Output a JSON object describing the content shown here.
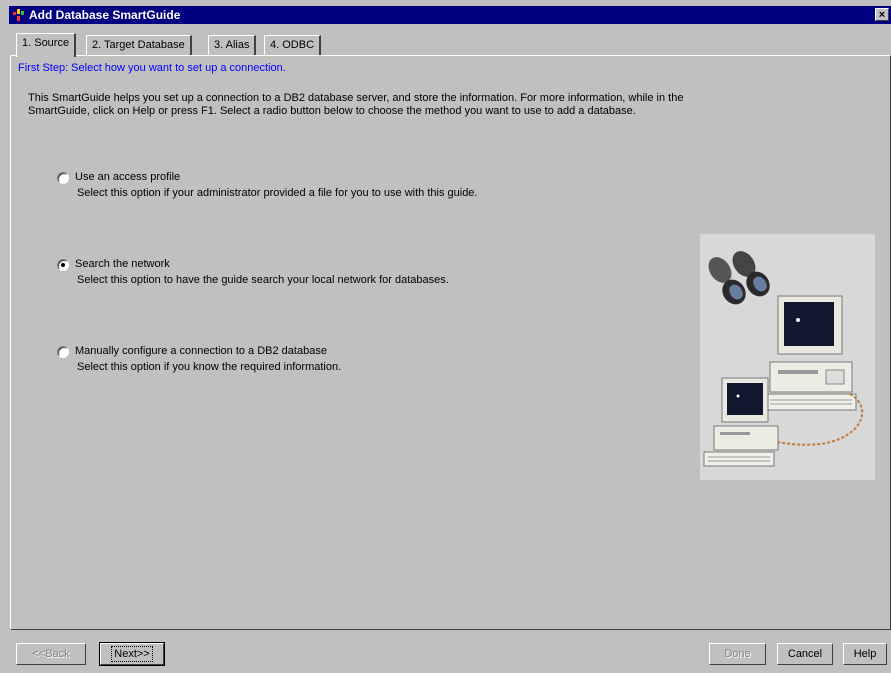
{
  "window": {
    "title": "Add Database SmartGuide",
    "close_glyph": "×"
  },
  "tabs": [
    {
      "label": "1. Source",
      "active": true
    },
    {
      "label": "2. Target Database",
      "active": false
    },
    {
      "label": "3. Alias",
      "active": false
    },
    {
      "label": "4. ODBC",
      "active": false
    }
  ],
  "step_heading": "First Step: Select how you want to set up a connection.",
  "intro": "This SmartGuide helps you set up a connection to a DB2 database server, and store the information.   For more information, while in the SmartGuide, click on Help or press F1.   Select a radio button below to choose the method you want to use to add a database.",
  "options": [
    {
      "label": "Use an access profile",
      "description": "Select this option if your administrator provided a file for you to use with this guide.",
      "selected": false
    },
    {
      "label": "Search the network",
      "description": "Select this option to have the guide search your local network for databases.",
      "selected": true
    },
    {
      "label": "Manually configure a connection to a DB2 database",
      "description": "Select this option if you know the required information.",
      "selected": false
    }
  ],
  "buttons": {
    "back": "<<Back",
    "next": "Next>>",
    "done": "Done",
    "cancel": "Cancel",
    "help": "Help"
  },
  "colors": {
    "title_bar": "#000080",
    "step_heading": "#0000ff",
    "face": "#c0c0c0"
  }
}
